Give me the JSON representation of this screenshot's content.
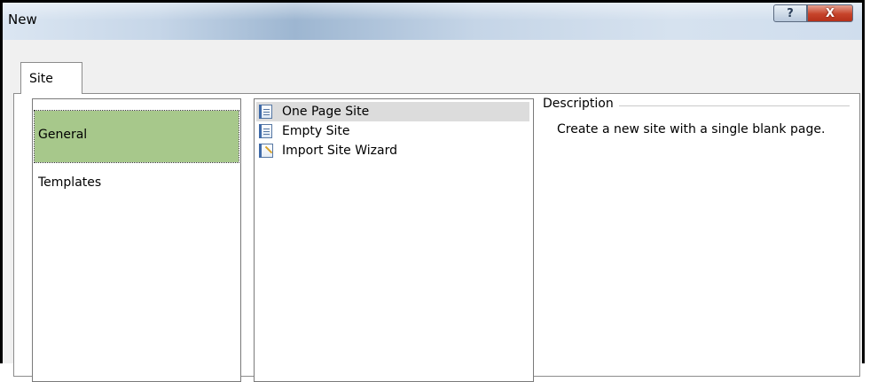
{
  "window": {
    "title": "New"
  },
  "titlebar": {
    "help_label": "?",
    "close_label": "X"
  },
  "tabs": [
    {
      "label": "Site"
    }
  ],
  "categories": [
    {
      "label": "General",
      "selected": true
    },
    {
      "label": "Templates",
      "selected": false
    }
  ],
  "sites": [
    {
      "label": "One Page Site",
      "icon": "page-icon",
      "selected": true
    },
    {
      "label": "Empty Site",
      "icon": "page-icon",
      "selected": false
    },
    {
      "label": "Import Site Wizard",
      "icon": "wizard-icon",
      "selected": false
    }
  ],
  "description": {
    "legend": "Description",
    "text": "Create a new site with a single blank page."
  },
  "colors": {
    "selected_category": "#a7c88b",
    "selected_site": "#dcdcdc",
    "close_button": "#c6432a"
  }
}
